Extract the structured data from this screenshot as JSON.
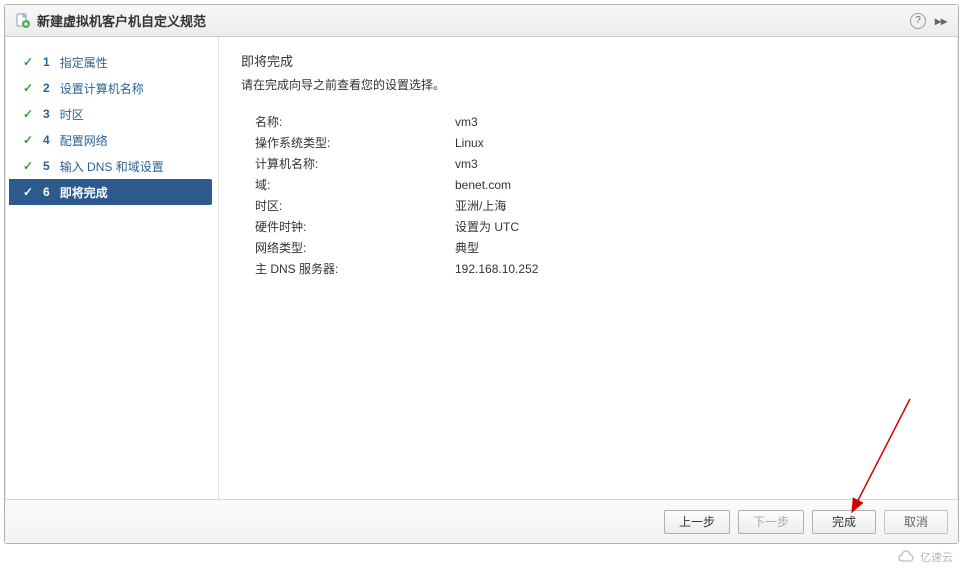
{
  "titlebar": {
    "title": "新建虚拟机客户机自定义规范"
  },
  "sidebar": {
    "steps": [
      {
        "num": "1",
        "label": "指定属性"
      },
      {
        "num": "2",
        "label": "设置计算机名称"
      },
      {
        "num": "3",
        "label": "时区"
      },
      {
        "num": "4",
        "label": "配置网络"
      },
      {
        "num": "5",
        "label": "输入 DNS 和域设置"
      },
      {
        "num": "6",
        "label": "即将完成"
      }
    ]
  },
  "content": {
    "title": "即将完成",
    "subtitle": "请在完成向导之前查看您的设置选择。",
    "summary": [
      {
        "label": "名称:",
        "value": "vm3"
      },
      {
        "label": "操作系统类型:",
        "value": "Linux"
      },
      {
        "label": "计算机名称:",
        "value": "vm3"
      },
      {
        "label": "域:",
        "value": "benet.com"
      },
      {
        "label": "时区:",
        "value": "亚洲/上海"
      },
      {
        "label": "硬件时钟:",
        "value": "设置为 UTC"
      },
      {
        "label": "网络类型:",
        "value": "典型"
      },
      {
        "label": "主 DNS 服务器:",
        "value": "192.168.10.252"
      }
    ]
  },
  "footer": {
    "back": "上一步",
    "next": "下一步",
    "finish": "完成",
    "cancel": "取消"
  },
  "watermark": "亿速云"
}
